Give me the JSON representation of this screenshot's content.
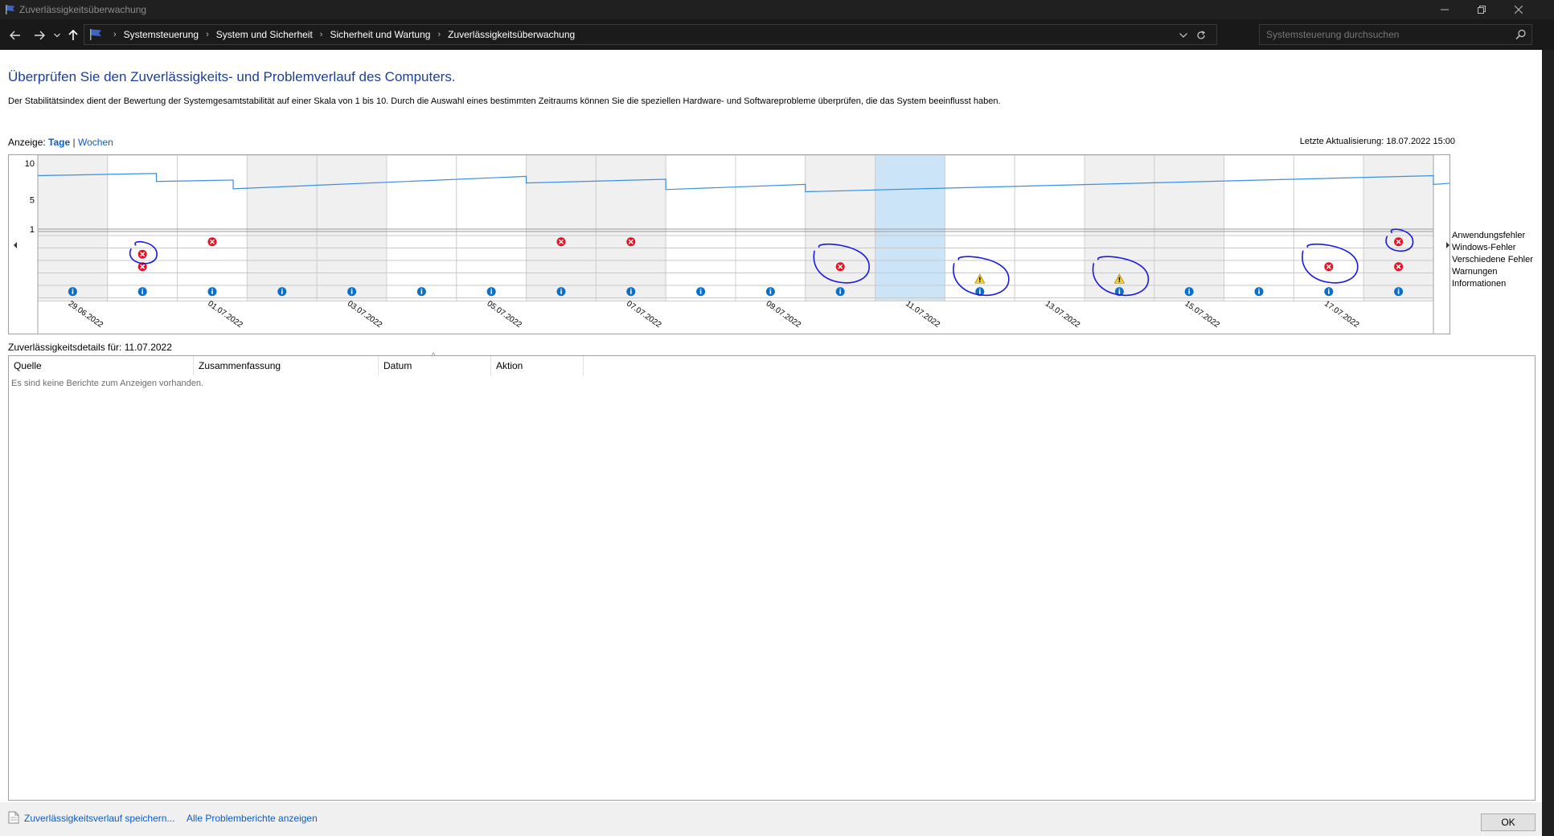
{
  "window": {
    "title": "Zuverlässigkeitsüberwachung"
  },
  "addressbar": {
    "breadcrumbs": [
      "Systemsteuerung",
      "System und Sicherheit",
      "Sicherheit und Wartung",
      "Zuverlässigkeitsüberwachung"
    ],
    "search_placeholder": "Systemsteuerung durchsuchen"
  },
  "main": {
    "title": "Überprüfen Sie den Zuverlässigkeits- und Problemverlauf des Computers.",
    "description": "Der Stabilitätsindex dient der Bewertung der Systemgesamtstabilität auf einer Skala von 1 bis 10. Durch die Auswahl eines bestimmten Zeitraums können Sie die speziellen Hardware- und Softwareprobleme überprüfen, die das System beeinflusst haben.",
    "view_label": "Anzeige:",
    "view_days": "Tage",
    "view_separator": "|",
    "view_weeks": "Wochen",
    "last_update": "Letzte Aktualisierung: 18.07.2022 15:00"
  },
  "chart_data": {
    "type": "line",
    "y_ticks": [
      "10",
      "5",
      "1"
    ],
    "ylim": [
      1,
      10
    ],
    "days": 20,
    "selected_day_index": 12,
    "x_tick_labels": [
      "29.06.2022",
      "01.07.2022",
      "03.07.2022",
      "05.07.2022",
      "07.07.2022",
      "09.07.2022",
      "11.07.2022",
      "13.07.2022",
      "15.07.2022",
      "17.07.2022"
    ],
    "stability_index": [
      [
        0,
        8.3
      ],
      [
        1.7,
        8.6
      ],
      [
        1.7,
        7.5
      ],
      [
        2.8,
        7.7
      ],
      [
        2.8,
        6.5
      ],
      [
        7.0,
        8.2
      ],
      [
        7.0,
        7.3
      ],
      [
        9.0,
        7.8
      ],
      [
        9.0,
        6.4
      ],
      [
        11.0,
        7.1
      ],
      [
        11.0,
        6.1
      ],
      [
        20.0,
        8.3
      ],
      [
        20.0,
        7.1
      ],
      [
        20.7,
        7.6
      ],
      [
        20.7,
        6.5
      ]
    ],
    "rows": [
      "Anwendungsfehler",
      "Windows-Fehler",
      "Verschiedene Fehler",
      "Warnungen",
      "Informationen"
    ],
    "events": {
      "errors": [
        [
          1,
          1
        ],
        [
          1,
          2
        ],
        [
          2,
          0
        ],
        [
          7,
          0
        ],
        [
          8,
          0
        ],
        [
          11,
          2
        ],
        [
          18,
          2
        ],
        [
          19,
          0
        ],
        [
          19,
          2
        ]
      ],
      "warnings": [
        13,
        15
      ],
      "info": [
        0,
        1,
        2,
        3,
        4,
        5,
        6,
        7,
        8,
        9,
        10,
        11,
        13,
        15,
        16,
        17,
        18,
        19
      ]
    },
    "annotations": [
      {
        "day": 1,
        "row": 1
      },
      {
        "day": 11,
        "row": 2
      },
      {
        "day": 13,
        "row": 3
      },
      {
        "day": 15,
        "row": 3
      },
      {
        "day": 18,
        "row": 2
      },
      {
        "day": 19,
        "row": 0
      }
    ],
    "colors": {
      "line": "#3a8ee6",
      "selected": "#cce4f7",
      "shaded": "#f0f0f0",
      "error": "#e81123",
      "warning": "#fcd116",
      "info": "#0b6fc7",
      "annotation": "#1a1ae0"
    }
  },
  "details": {
    "label": "Zuverlässigkeitsdetails für: 11.07.2022",
    "columns": [
      "Quelle",
      "Zusammenfassung",
      "Datum",
      "Aktion"
    ],
    "empty_message": "Es sind keine Berichte zum Anzeigen vorhanden."
  },
  "footer": {
    "save_link": "Zuverlässigkeitsverlauf speichern...",
    "all_reports_link": "Alle Problemberichte anzeigen",
    "ok_label": "OK"
  }
}
